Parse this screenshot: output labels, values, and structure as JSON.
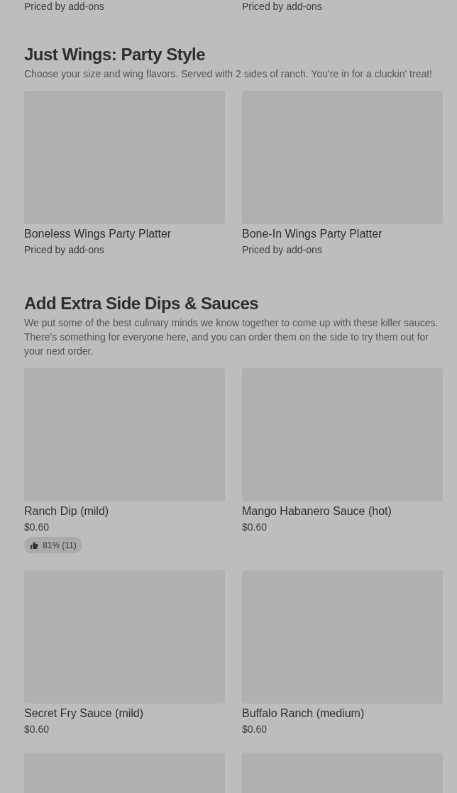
{
  "previous_section_items": [
    {
      "price": "Priced by add-ons"
    },
    {
      "price": "Priced by add-ons"
    }
  ],
  "sections": [
    {
      "title": "Just Wings: Party Style",
      "description": "Choose your size and wing flavors. Served with 2 sides of ranch. You're in for a cluckin' treat!",
      "items": [
        {
          "kind": "item",
          "name": "Boneless Wings Party Platter",
          "price": "Priced by add-ons"
        },
        {
          "kind": "item",
          "name": "Bone-In Wings Party Platter",
          "price": "Priced by add-ons"
        }
      ]
    },
    {
      "title": "Add Extra Side Dips & Sauces",
      "description": "We put some of the best culinary minds we know together to come up with these killer sauces. There's something for everyone here, and you can order them on the side to try them out for your next order.",
      "items": [
        {
          "kind": "item",
          "name": "Ranch Dip (mild)",
          "price": "$0.60",
          "rating": "81% (11)"
        },
        {
          "kind": "item",
          "name": "Mango Habanero Sauce (hot)",
          "price": "$0.60"
        },
        {
          "kind": "item",
          "name": "Secret Fry Sauce (mild)",
          "price": "$0.60"
        },
        {
          "kind": "item",
          "name": "Buffalo Ranch (medium)",
          "price": "$0.60"
        },
        {
          "kind": "cut"
        },
        {
          "kind": "cut"
        }
      ]
    }
  ]
}
